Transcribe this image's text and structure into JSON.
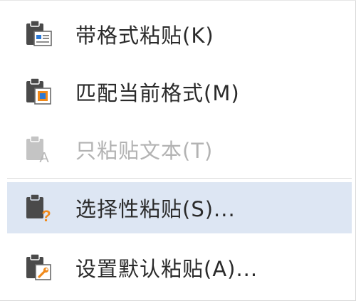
{
  "menu": {
    "items": [
      {
        "label": "带格式粘贴(K)",
        "icon": "paste-with-format-icon",
        "enabled": true,
        "highlighted": false
      },
      {
        "label": "匹配当前格式(M)",
        "icon": "paste-match-format-icon",
        "enabled": true,
        "highlighted": false
      },
      {
        "label": "只粘贴文本(T)",
        "icon": "paste-text-only-icon",
        "enabled": false,
        "highlighted": false
      },
      {
        "label": "选择性粘贴(S)...",
        "icon": "paste-special-icon",
        "enabled": true,
        "highlighted": true
      },
      {
        "label": "设置默认粘贴(A)...",
        "icon": "set-default-paste-icon",
        "enabled": true,
        "highlighted": false
      }
    ]
  },
  "colors": {
    "highlight_bg": "#dde6f3",
    "text": "#2a2a2a",
    "disabled_text": "#b3b3b3",
    "icon_dark": "#4a4a4a",
    "accent_blue": "#2b79d6",
    "accent_orange": "#f08a1c"
  }
}
